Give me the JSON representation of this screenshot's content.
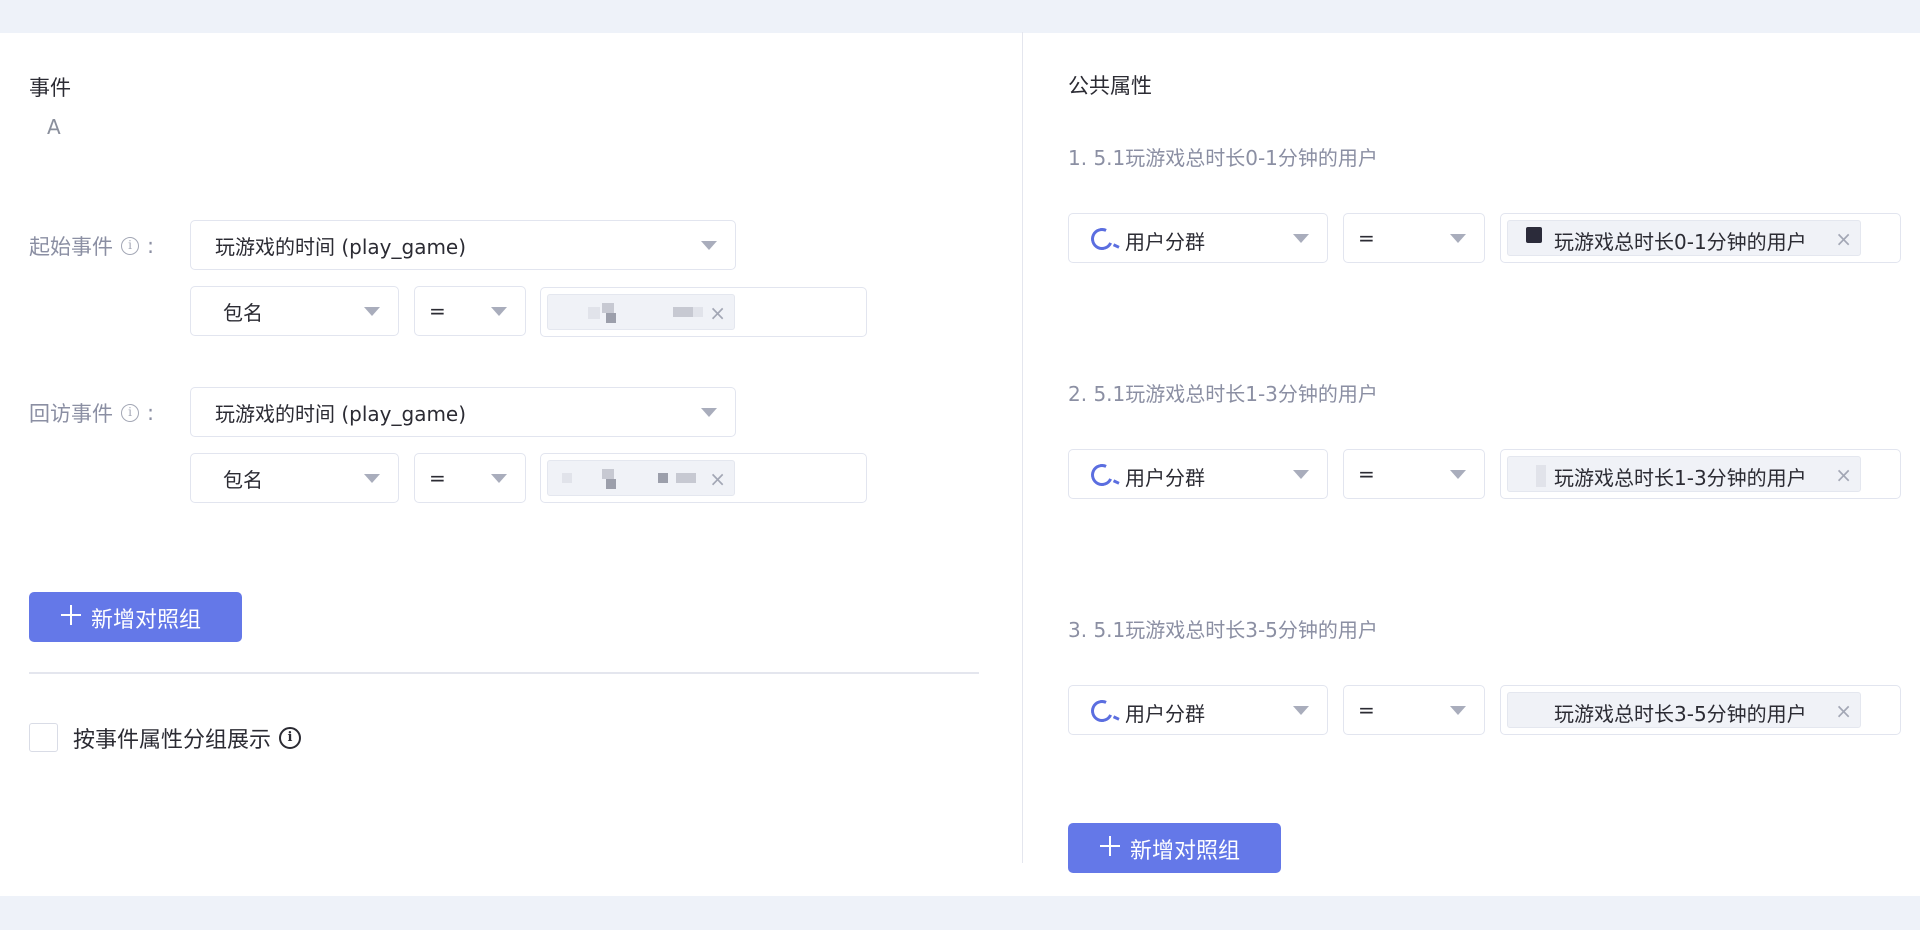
{
  "events": {
    "title": "事件",
    "group_letter": "A",
    "start": {
      "label": "起始事件",
      "event": "玩游戏的时间 (play_game)",
      "property": "包名",
      "operator": "="
    },
    "return": {
      "label": "回访事件",
      "event": "玩游戏的时间 (play_game)",
      "property": "包名",
      "operator": "="
    },
    "add_group_label": "新增对照组",
    "group_by_label": "按事件属性分组展示"
  },
  "attributes": {
    "title": "公共属性",
    "groups": [
      {
        "title": "1. 5.1玩游戏总时长0-1分钟的用户",
        "property": "用户分群",
        "operator": "=",
        "value": "玩游戏总时长0-1分钟的用户"
      },
      {
        "title": "2. 5.1玩游戏总时长1-3分钟的用户",
        "property": "用户分群",
        "operator": "=",
        "value": "玩游戏总时长1-3分钟的用户"
      },
      {
        "title": "3. 5.1玩游戏总时长3-5分钟的用户",
        "property": "用户分群",
        "operator": "=",
        "value": "玩游戏总时长3-5分钟的用户"
      }
    ],
    "add_group_label": "新增对照组"
  },
  "icons": {
    "info": "info-circle-icon",
    "caret": "caret-down-icon",
    "close": "close-icon",
    "plus": "plus-icon",
    "segment": "user-segment-icon"
  },
  "colors": {
    "primary": "#6478e8",
    "muted_text": "#8b8fa3",
    "background": "#eef2f9"
  }
}
